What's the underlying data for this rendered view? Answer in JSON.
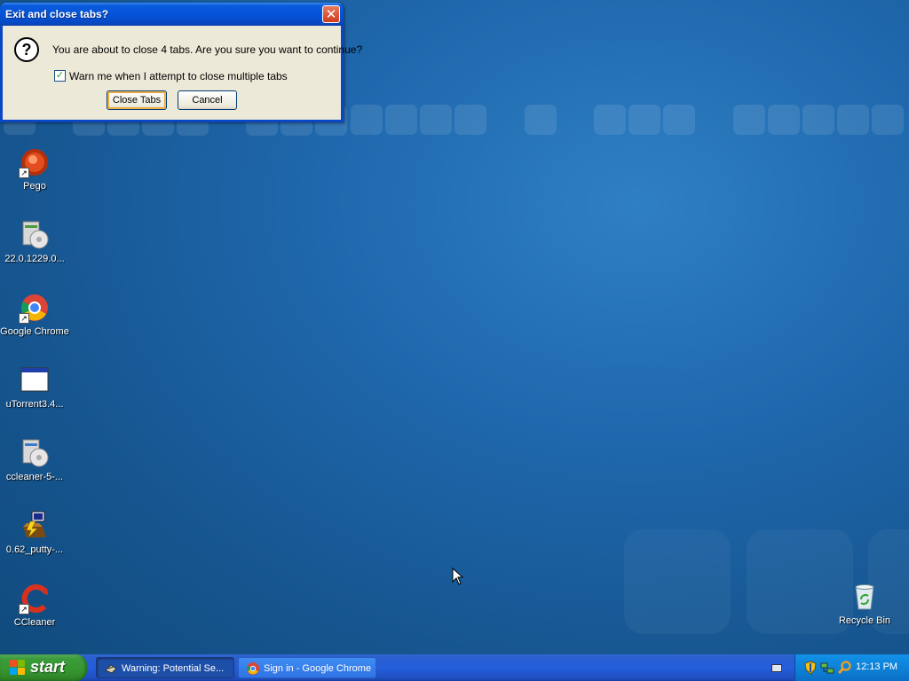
{
  "dialog": {
    "title": "Exit and close tabs?",
    "close_glyph": "✕",
    "icon": "question-icon",
    "message": "You are about to close 4 tabs. Are you sure you want to continue?",
    "checkbox_label": "Warn me when I attempt to close multiple tabs",
    "checkbox_checked": true,
    "buttons": {
      "close_tabs": "Close Tabs",
      "cancel": "Cancel"
    }
  },
  "desktop": {
    "icons": [
      {
        "label": "Pego",
        "icon": "pego-icon"
      },
      {
        "label": "22.0.1229.0...",
        "icon": "installer-disc-icon"
      },
      {
        "label": "Google Chrome",
        "icon": "chrome-icon"
      },
      {
        "label": "uTorrent3.4...",
        "icon": "window-app-icon"
      },
      {
        "label": "ccleaner-5-...",
        "icon": "installer-disc-icon"
      },
      {
        "label": "0.62_putty-...",
        "icon": "putty-icon"
      },
      {
        "label": "CCleaner",
        "icon": "ccleaner-icon"
      }
    ],
    "recycle_bin": {
      "label": "Recycle Bin",
      "icon": "recycle-bin-icon"
    }
  },
  "taskbar": {
    "start_label": "start",
    "buttons": [
      {
        "label": "Warning: Potential Se...",
        "icon": "warning-icon",
        "active": true
      },
      {
        "label": "Sign in - Google Chrome",
        "icon": "chrome-icon",
        "active": false
      }
    ],
    "tray": {
      "icons": [
        "keyboard-icon",
        "security-shield-icon",
        "network-icon",
        "search-icon"
      ],
      "time": "12:13 PM"
    }
  },
  "colors": {
    "desktop_blue": "#1f68ad",
    "taskbar_blue": "#245edb",
    "start_green": "#36962f",
    "dialog_face": "#ece9d8",
    "title_blue": "#0553d9"
  }
}
